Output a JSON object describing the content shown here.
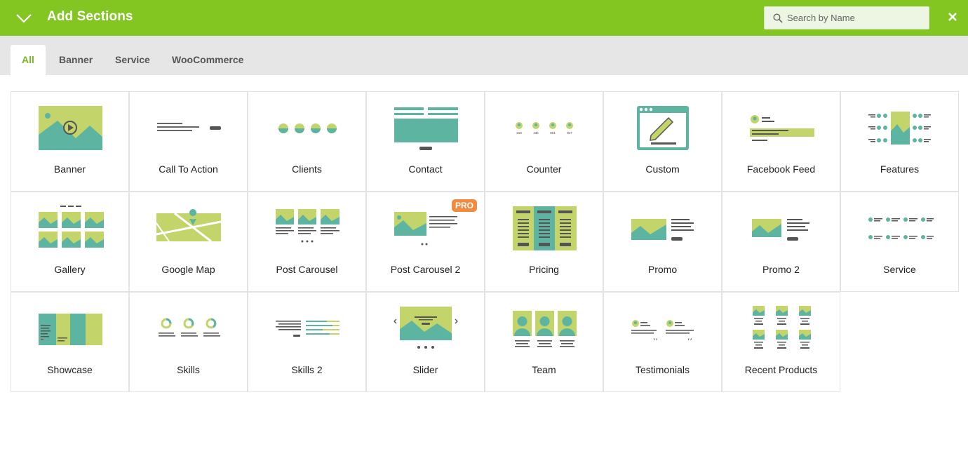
{
  "header": {
    "title": "Add Sections",
    "search_placeholder": "Search by Name",
    "accent_color": "#83c521"
  },
  "tabs": [
    {
      "label": "All",
      "active": true
    },
    {
      "label": "Banner",
      "active": false
    },
    {
      "label": "Service",
      "active": false
    },
    {
      "label": "WooCommerce",
      "active": false
    }
  ],
  "sections": [
    {
      "label": "Banner",
      "icon": "banner-icon"
    },
    {
      "label": "Call To Action",
      "icon": "call-to-action-icon"
    },
    {
      "label": "Clients",
      "icon": "clients-icon"
    },
    {
      "label": "Contact",
      "icon": "contact-icon"
    },
    {
      "label": "Counter",
      "icon": "counter-icon"
    },
    {
      "label": "Custom",
      "icon": "custom-icon"
    },
    {
      "label": "Facebook Feed",
      "icon": "facebook-feed-icon"
    },
    {
      "label": "Features",
      "icon": "features-icon"
    },
    {
      "label": "Gallery",
      "icon": "gallery-icon"
    },
    {
      "label": "Google Map",
      "icon": "google-map-icon"
    },
    {
      "label": "Post Carousel",
      "icon": "post-carousel-icon"
    },
    {
      "label": "Post Carousel 2",
      "icon": "post-carousel-2-icon",
      "badge": "PRO"
    },
    {
      "label": "Pricing",
      "icon": "pricing-icon"
    },
    {
      "label": "Promo",
      "icon": "promo-icon"
    },
    {
      "label": "Promo 2",
      "icon": "promo-2-icon"
    },
    {
      "label": "Service",
      "icon": "service-icon"
    },
    {
      "label": "Showcase",
      "icon": "showcase-icon"
    },
    {
      "label": "Skills",
      "icon": "skills-icon"
    },
    {
      "label": "Skills 2",
      "icon": "skills-2-icon"
    },
    {
      "label": "Slider",
      "icon": "slider-icon"
    },
    {
      "label": "Team",
      "icon": "team-icon"
    },
    {
      "label": "Testimonials",
      "icon": "testimonials-icon"
    },
    {
      "label": "Recent Products",
      "icon": "recent-products-icon"
    }
  ],
  "counter_values": [
    "310",
    "43k",
    "801",
    "947"
  ]
}
